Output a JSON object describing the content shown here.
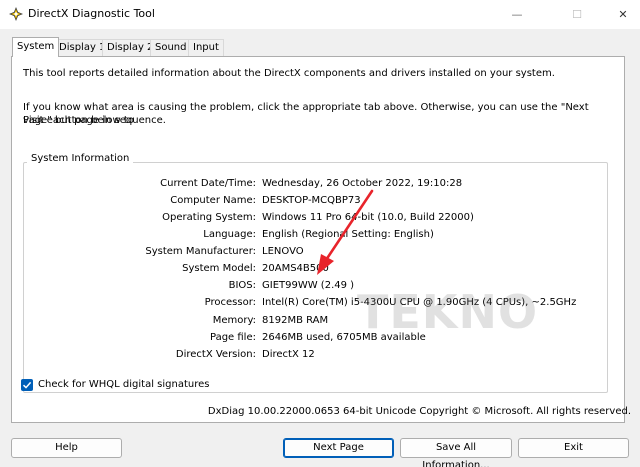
{
  "window": {
    "title": "DirectX Diagnostic Tool"
  },
  "tabs": [
    {
      "label": "System",
      "active": true
    },
    {
      "label": "Display 1"
    },
    {
      "label": "Display 2"
    },
    {
      "label": "Sound"
    },
    {
      "label": "Input"
    }
  ],
  "intro": {
    "line1": "This tool reports detailed information about the DirectX components and drivers installed on your system.",
    "line2": "If you know what area is causing the problem, click the appropriate tab above.  Otherwise, you can use the \"Next Page\" button below to",
    "line3": "visit each page in sequence."
  },
  "system_info": {
    "title": "System Information",
    "rows": [
      {
        "label": "Current Date/Time:",
        "value": "Wednesday, 26 October 2022, 19:10:28"
      },
      {
        "label": "Computer Name:",
        "value": "DESKTOP-MCQBP73"
      },
      {
        "label": "Operating System:",
        "value": "Windows 11 Pro 64-bit (10.0, Build 22000)"
      },
      {
        "label": "Language:",
        "value": "English (Regional Setting: English)"
      },
      {
        "label": "System Manufacturer:",
        "value": "LENOVO"
      },
      {
        "label": "System Model:",
        "value": "20AMS4B500"
      },
      {
        "label": "BIOS:",
        "value": "GIET99WW (2.49 )"
      },
      {
        "label": "Processor:",
        "value": "Intel(R) Core(TM) i5-4300U CPU @ 1.90GHz (4 CPUs), ~2.5GHz"
      },
      {
        "label": "Memory:",
        "value": "8192MB RAM"
      },
      {
        "label": "Page file:",
        "value": "2646MB used, 6705MB available"
      },
      {
        "label": "DirectX Version:",
        "value": "DirectX 12"
      }
    ]
  },
  "whql": {
    "label": "Check for WHQL digital signatures",
    "checked": true
  },
  "footer": {
    "copyright": "DxDiag 10.00.22000.0653 64-bit Unicode  Copyright © Microsoft. All rights reserved."
  },
  "buttons": {
    "help": "Help",
    "next_page": "Next Page",
    "save_all": "Save All Information...",
    "exit": "Exit"
  },
  "watermark": "TEKNO",
  "colors": {
    "accent": "#005fb8",
    "annotation_arrow": "#e8242b"
  }
}
